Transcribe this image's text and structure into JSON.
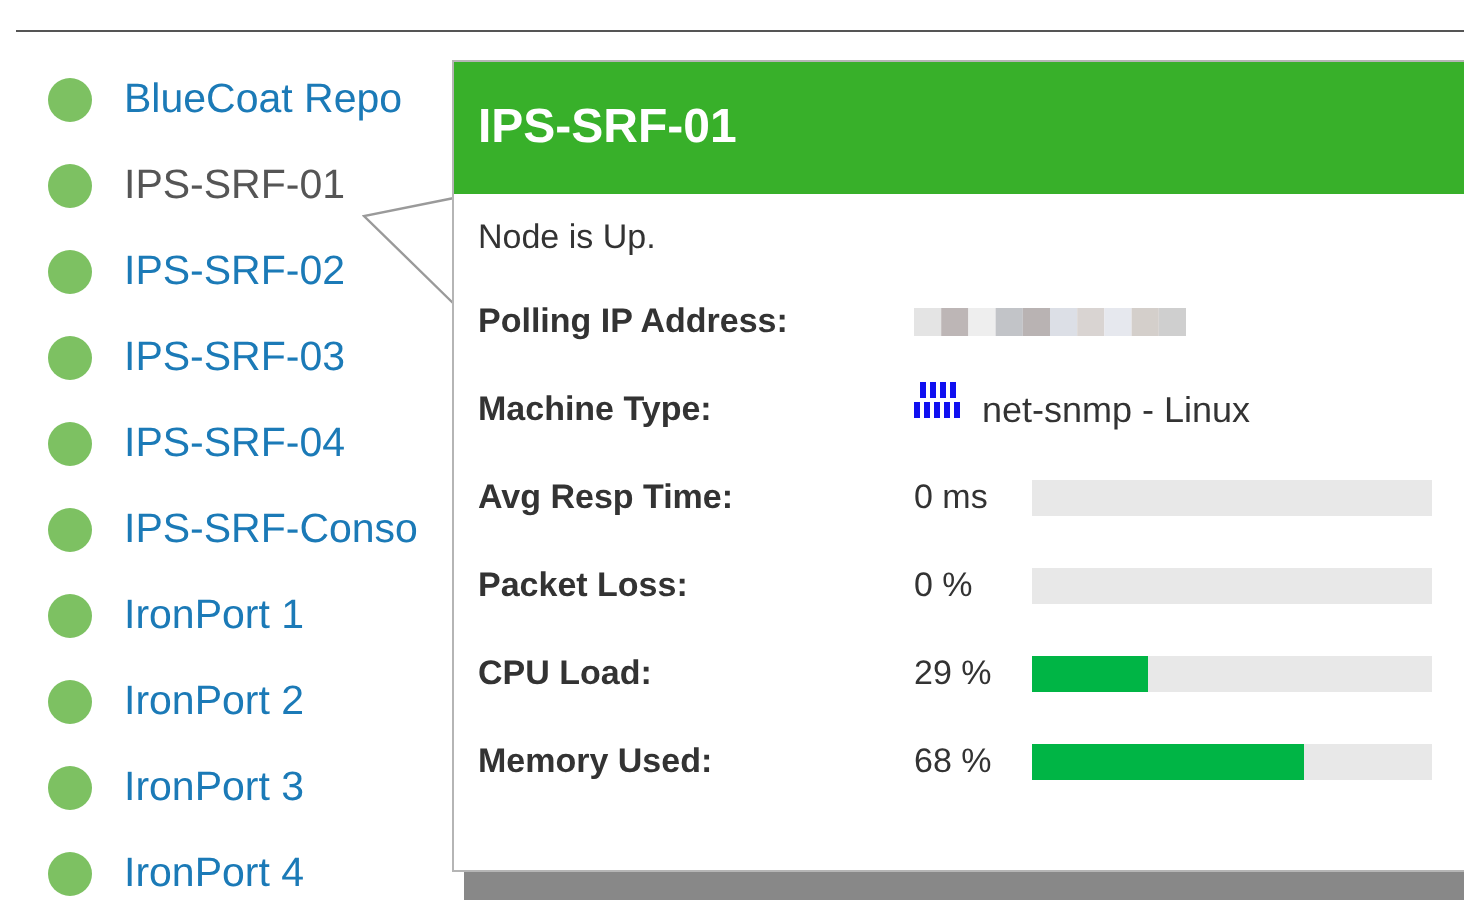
{
  "nodes": [
    {
      "name": "BlueCoat Repo",
      "hovered": false
    },
    {
      "name": "IPS-SRF-01",
      "hovered": true
    },
    {
      "name": "IPS-SRF-02",
      "hovered": false
    },
    {
      "name": "IPS-SRF-03",
      "hovered": false
    },
    {
      "name": "IPS-SRF-04",
      "hovered": false
    },
    {
      "name": "IPS-SRF-Conso",
      "hovered": false
    },
    {
      "name": "IronPort 1",
      "hovered": false
    },
    {
      "name": "IronPort 2",
      "hovered": false
    },
    {
      "name": "IronPort 3",
      "hovered": false
    },
    {
      "name": "IronPort 4",
      "hovered": false
    }
  ],
  "tooltip": {
    "title": "IPS-SRF-01",
    "status": "Node is Up.",
    "details": [
      {
        "kind": "blurred",
        "label": "Polling IP Address:"
      },
      {
        "kind": "machine",
        "label": "Machine Type:",
        "value": "net-snmp - Linux"
      },
      {
        "kind": "meter",
        "label": "Avg Resp Time:",
        "value": "0 ms"
      },
      {
        "kind": "meter",
        "label": "Packet Loss:",
        "value": "0 %"
      },
      {
        "kind": "meter",
        "label": "CPU Load:",
        "value": "29 %",
        "level": 0.29
      },
      {
        "kind": "meter",
        "label": "Memory Used:",
        "value": "68 %",
        "level": 0.68
      }
    ]
  }
}
